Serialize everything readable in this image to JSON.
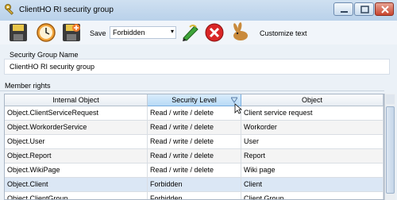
{
  "window": {
    "title": "ClientHO RI security group"
  },
  "toolbar": {
    "save_label": "Save",
    "level_select": {
      "value": "Forbidden",
      "arrow": "▾"
    },
    "customize_label": "Customize text",
    "icons": [
      "save-icon",
      "schedule-icon",
      "save-copy-icon",
      "edit-pencil-icon",
      "delete-icon",
      "rabbit-icon"
    ]
  },
  "form": {
    "group_name_label": "Security Group Name",
    "group_name_value": "ClientHO RI security group",
    "member_rights_label": "Member rights"
  },
  "grid": {
    "columns": [
      "Internal Object",
      "Security Level",
      "Object"
    ],
    "sorted_column": "Security Level",
    "rows": [
      {
        "internal": "Object.ClientServiceRequest",
        "level": "Read / write / delete",
        "object": "Client service request"
      },
      {
        "internal": "Object.WorkorderService",
        "level": "Read / write / delete",
        "object": "Workorder"
      },
      {
        "internal": "Object.User",
        "level": "Read / write / delete",
        "object": "User"
      },
      {
        "internal": "Object.Report",
        "level": "Read / write / delete",
        "object": "Report"
      },
      {
        "internal": "Object.WikiPage",
        "level": "Read / write / delete",
        "object": "Wiki page"
      },
      {
        "internal": "Object.Client",
        "level": "Forbidden",
        "object": "Client"
      },
      {
        "internal": "Object.ClientGroup",
        "level": "Forbidden",
        "object": "Client Group"
      }
    ]
  },
  "colors": {
    "accent": "#79aee0",
    "close": "#c8452f"
  }
}
